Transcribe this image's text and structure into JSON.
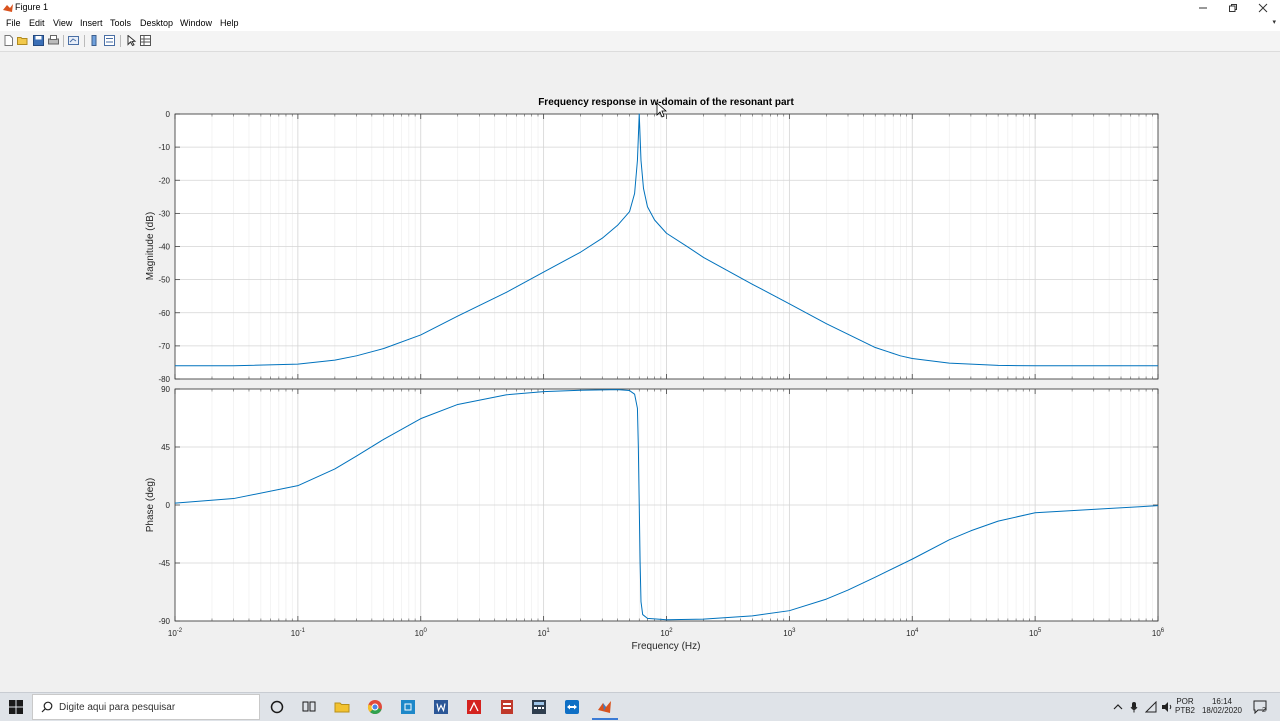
{
  "window": {
    "title": "Figure 1"
  },
  "menu": [
    "File",
    "Edit",
    "View",
    "Insert",
    "Tools",
    "Desktop",
    "Window",
    "Help"
  ],
  "toolbar": {
    "icons": [
      "new-figure-icon",
      "open-file-icon",
      "save-icon",
      "print-icon",
      "link-plot-icon",
      "colorbar-icon",
      "legend-icon",
      "pointer-icon",
      "property-editor-icon"
    ]
  },
  "chart_data": {
    "type": "line",
    "title": "Frequency response in w-domain of the resonant part",
    "xlabel": "Frequency (Hz)",
    "xscale": "log",
    "xlim": [
      0.01,
      1000000
    ],
    "x_ticks": [
      {
        "base": "10",
        "exp": "-2"
      },
      {
        "base": "10",
        "exp": "-1"
      },
      {
        "base": "10",
        "exp": "0"
      },
      {
        "base": "10",
        "exp": "1"
      },
      {
        "base": "10",
        "exp": "2"
      },
      {
        "base": "10",
        "exp": "3"
      },
      {
        "base": "10",
        "exp": "4"
      },
      {
        "base": "10",
        "exp": "5"
      },
      {
        "base": "10",
        "exp": "6"
      }
    ],
    "grid": true,
    "line_color": "#0072bd",
    "panels": [
      {
        "name": "magnitude",
        "ylabel": "Magnitude (dB)",
        "ylim": [
          -80,
          0
        ],
        "yticks": [
          "0",
          "-10",
          "-20",
          "-30",
          "-40",
          "-50",
          "-60",
          "-70",
          "-80"
        ],
        "x": [
          0.01,
          0.03,
          0.1,
          0.2,
          0.3,
          0.5,
          1,
          2,
          5,
          10,
          20,
          30,
          40,
          50,
          55,
          58,
          60,
          62,
          65,
          70,
          80,
          100,
          150,
          200,
          500,
          1000,
          2000,
          5000,
          8000,
          10000,
          20000,
          50000,
          100000,
          1000000
        ],
        "y": [
          -76.0,
          -76.0,
          -75.5,
          -74.3,
          -73.0,
          -70.8,
          -66.7,
          -61.0,
          -53.8,
          -47.7,
          -41.7,
          -37.5,
          -33.6,
          -29.5,
          -24.0,
          -14.0,
          0.0,
          -14.0,
          -22.5,
          -28.0,
          -32.0,
          -36.0,
          -40.2,
          -43.3,
          -51.4,
          -57.3,
          -63.3,
          -70.5,
          -73.0,
          -73.8,
          -75.2,
          -75.9,
          -76.0,
          -76.0
        ]
      },
      {
        "name": "phase",
        "ylabel": "Phase (deg)",
        "ylim": [
          -90,
          90
        ],
        "yticks": [
          "90",
          "45",
          "0",
          "-45",
          "-90"
        ],
        "x": [
          0.01,
          0.03,
          0.1,
          0.2,
          0.3,
          0.5,
          1,
          2,
          5,
          10,
          20,
          40,
          50,
          55,
          58,
          59,
          60,
          61,
          62,
          64,
          70,
          100,
          200,
          500,
          1000,
          2000,
          3000,
          5000,
          10000,
          20000,
          30000,
          50000,
          100000,
          1000000
        ],
        "y": [
          1.5,
          5,
          15,
          28,
          38,
          51,
          67,
          78,
          85.5,
          88,
          89,
          89.5,
          88.8,
          86,
          75,
          45,
          0,
          -45,
          -75,
          -85,
          -88,
          -89,
          -88.5,
          -86,
          -82,
          -73,
          -66,
          -56,
          -42,
          -27,
          -20,
          -12.5,
          -6,
          -0.5
        ]
      }
    ]
  },
  "taskbar": {
    "search_placeholder": "Digite aqui para pesquisar",
    "apps": [
      "windows-start-icon",
      "cortana-icon",
      "task-view-icon",
      "file-explorer-icon",
      "chrome-icon",
      "store-icon",
      "word-icon",
      "acrobat-icon",
      "pdf-tool-icon",
      "calculator-icon",
      "teamviewer-icon",
      "matlab-icon"
    ],
    "lang_top": "POR",
    "lang_bottom": "PTB2",
    "time": "16:14",
    "date": "18/02/2020",
    "notification_count": "2"
  }
}
